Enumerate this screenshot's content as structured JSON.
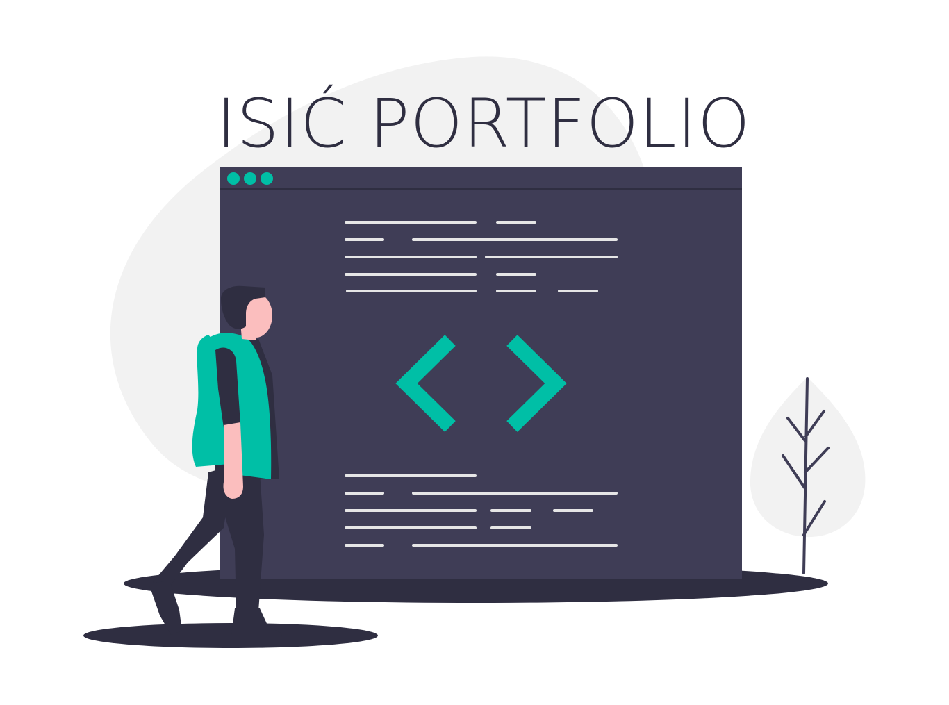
{
  "title": "ISIĆ PORTFOLIO",
  "colors": {
    "text": "#2f2e41",
    "accent": "#00bfa6",
    "dark": "#3f3d56",
    "background_blob": "#f2f2f2",
    "line": "#e6e6e6",
    "skin": "#fbbebe",
    "shadow": "#2f2e41"
  },
  "illustration": {
    "window": {
      "traffic_lights": [
        "dot",
        "dot",
        "dot"
      ],
      "center_icon": "code-brackets-icon"
    },
    "figure": "person-walking",
    "plant": "leaf-tree-icon"
  }
}
